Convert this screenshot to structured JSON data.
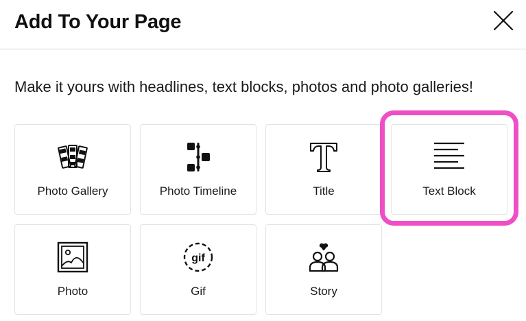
{
  "dialog": {
    "title": "Add To Your Page",
    "intro": "Make it yours with headlines, text blocks, photos and photo galleries!",
    "close_icon": "close-icon"
  },
  "options": [
    {
      "label": "Photo Gallery",
      "icon": "photo-gallery-icon"
    },
    {
      "label": "Photo Timeline",
      "icon": "photo-timeline-icon"
    },
    {
      "label": "Title",
      "icon": "title-icon"
    },
    {
      "label": "Text Block",
      "icon": "text-block-icon",
      "highlighted": true
    },
    {
      "label": "Photo",
      "icon": "photo-icon"
    },
    {
      "label": "Gif",
      "icon": "gif-icon",
      "icon_text": "gif"
    },
    {
      "label": "Story",
      "icon": "story-icon"
    }
  ],
  "colors": {
    "highlight": "#ee4fc5",
    "divider": "#d4d4d4",
    "tile_border": "#e3e3e3"
  }
}
